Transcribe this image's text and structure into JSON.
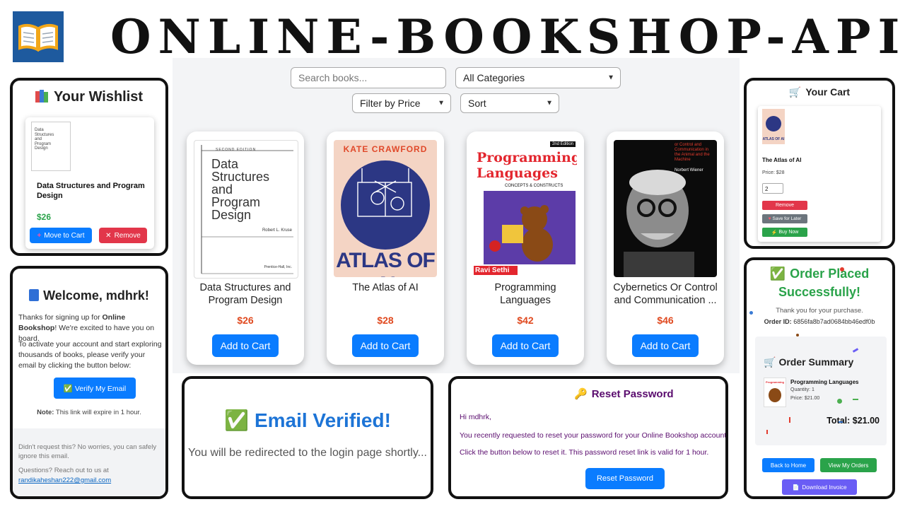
{
  "banner": {
    "title": "ONLINE-BOOKSHOP-API",
    "logo_icon": "open-book-icon"
  },
  "filters": {
    "search_placeholder": "Search books...",
    "category": "All Categories",
    "price": "Filter by Price",
    "sort": "Sort"
  },
  "books": [
    {
      "title": "Data Structures and Program Design",
      "price": "$26",
      "button": "Add to Cart"
    },
    {
      "title": "The Atlas of AI",
      "price": "$28",
      "button": "Add to Cart"
    },
    {
      "title": "Programming Languages",
      "price": "$42",
      "button": "Add to Cart"
    },
    {
      "title": "Cybernetics Or Control and Communication ...",
      "price": "$46",
      "button": "Add to Cart"
    }
  ],
  "covers": {
    "ds": {
      "edition": "SECOND EDITION",
      "title_lines": [
        "Data",
        "Structures",
        "and",
        "Program",
        "Design"
      ],
      "author": "Robert L. Kruse",
      "publisher": "Prentice-Hall, Inc."
    },
    "atlas": {
      "author": "KATE CRAWFORD",
      "title": "ATLAS OF AI"
    },
    "pl": {
      "title_line1": "Programming",
      "title_line2": "Languages",
      "subtitle": "CONCEPTS & CONSTRUCTS",
      "edition": "2nd Edition",
      "author": "Ravi Sethi"
    },
    "cyb": {
      "subtitle": "or Control and Communication in the Animal and the Machine",
      "author": "Norbert Wiener"
    }
  },
  "wishlist": {
    "title": "Your Wishlist",
    "icon": "books-icon",
    "item_title": "Data Structures and Program Design",
    "item_price": "$26",
    "move_label": "Move to Cart",
    "remove_label": "Remove"
  },
  "welcome": {
    "heading": "Welcome, mdhrk!",
    "icon": "blue-book-icon",
    "p1_pre": "Thanks for signing up for ",
    "p1_bold": "Online Bookshop",
    "p1_post": "! We're excited to have you on board.",
    "p2": "To activate your account and start exploring thousands of books, please verify your email by clicking the button below:",
    "button": "✅ Verify My Email",
    "note_bold": "Note:",
    "note": " This link will expire in 1 hour.",
    "footer1": "Didn't request this? No worries, you can safely ignore this email.",
    "footer2": "Questions? Reach out to us at",
    "email": "randikaheshan222@gmail.com"
  },
  "verified": {
    "icon": "✅",
    "title": "Email Verified!",
    "message": "You will be redirected to the login page shortly..."
  },
  "reset": {
    "icon": "🔑",
    "title": "Reset Password",
    "greeting": "Hi mdhrk,",
    "line1": "You recently requested to reset your password for your Online Bookshop account.",
    "line2": "Click the button below to reset it. This password reset link is valid for 1 hour.",
    "button": "Reset Password"
  },
  "cart": {
    "title": "Your Cart",
    "icon": "cart-icon",
    "item_title": "The Atlas of AI",
    "price": "Price: $28",
    "quantity": "2",
    "remove_label": "Remove",
    "save_label": "Save for Later",
    "buy_label": "Buy Now",
    "cover_title": "ATLAS OF AI"
  },
  "order": {
    "icon": "✅",
    "title_line1": "Order Placed",
    "title_line2": "Successfully!",
    "thanks": "Thank you for your purchase.",
    "id_label": "Order ID:",
    "id_value": "6856fa8b7ad0684bb46edf0b",
    "summary_title": "Order Summary",
    "summary_icon": "cart-icon",
    "item_title": "Programming Languages",
    "item_qty": "Quantity: 1",
    "item_price": "Price: $21.00",
    "total": "Total: $21.00",
    "back_label": "Back to Home",
    "orders_label": "View My Orders",
    "invoice_label": "Download Invoice"
  }
}
